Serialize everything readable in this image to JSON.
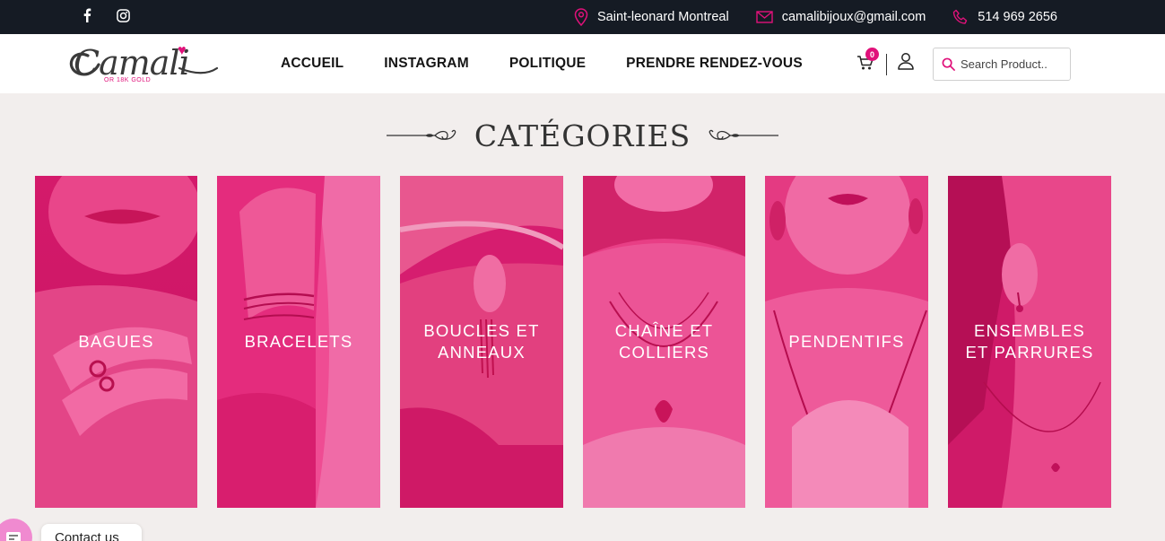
{
  "topbar": {
    "location": "Saint-leonard Montreal",
    "email": "camalibijoux@gmail.com",
    "phone": "514 969 2656"
  },
  "header": {
    "logo": {
      "brand": "Camali",
      "subtitle": "OR 18K GOLD"
    },
    "nav": [
      "ACCUEIL",
      "INSTAGRAM",
      "POLITIQUE",
      "PRENDRE RENDEZ-VOUS"
    ],
    "cart_count": "0",
    "search_placeholder": "Search Product.."
  },
  "section_title": "CATÉGORIES",
  "categories": [
    {
      "label": "BAGUES",
      "icon": "rings-photo"
    },
    {
      "label": "BRACELETS",
      "icon": "bracelets-photo"
    },
    {
      "label": "BOUCLES ET\nANNEAUX",
      "icon": "earrings-photo"
    },
    {
      "label": "CHAÎNE ET\nCOLLIERS",
      "icon": "necklace-photo"
    },
    {
      "label": "PENDENTIFS",
      "icon": "pendant-photo"
    },
    {
      "label": "ENSEMBLES\nET PARRURES",
      "icon": "jewelry-set-photo"
    }
  ],
  "contact_widget": {
    "label": "Contact us"
  },
  "colors": {
    "accent": "#e0117a",
    "topbar_bg": "#151b24",
    "card_overlay": "#e8347f",
    "page_bg": "#f2eeed"
  }
}
